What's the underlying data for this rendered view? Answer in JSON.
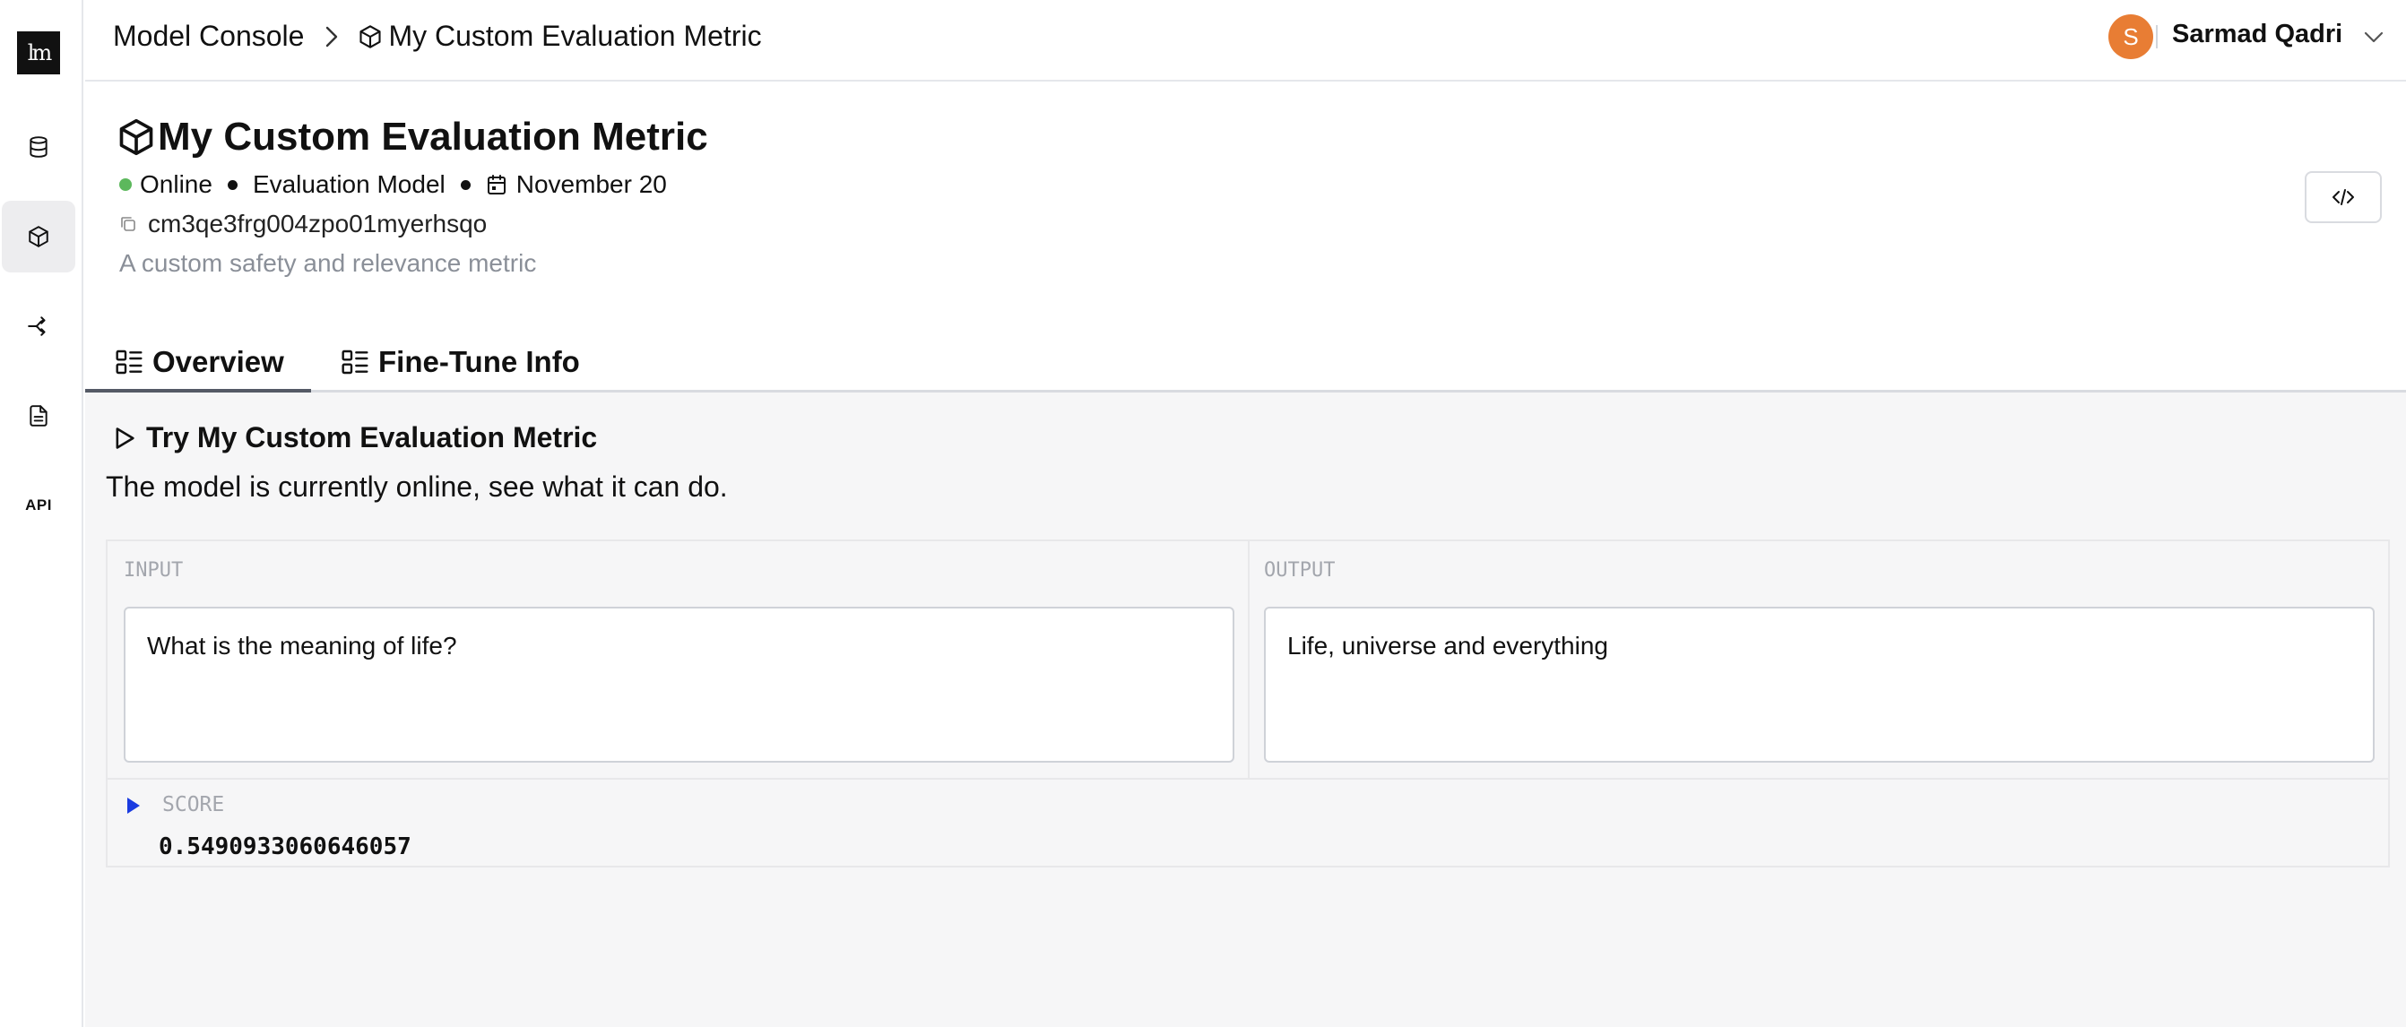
{
  "sidebar": {
    "logo_text": "lm",
    "items": [
      {
        "icon": "database-icon"
      },
      {
        "icon": "cube-icon",
        "active": true
      },
      {
        "icon": "flow-icon"
      },
      {
        "icon": "document-icon"
      },
      {
        "icon": "api-icon",
        "label": "API"
      }
    ]
  },
  "header": {
    "breadcrumb_root": "Model Console",
    "breadcrumb_current": "My Custom Evaluation Metric",
    "user_initial": "S",
    "user_name": "Sarmad Qadri",
    "avatar_color": "#e87d34"
  },
  "model": {
    "title": "My Custom Evaluation Metric",
    "status": "Online",
    "status_color": "#5cb85c",
    "type": "Evaluation Model",
    "date": "November 20",
    "id": "cm3qe3frg004zpo01myerhsqo",
    "description": "A custom safety and relevance metric"
  },
  "tabs": [
    {
      "label": "Overview",
      "active": true
    },
    {
      "label": "Fine-Tune Info",
      "active": false
    }
  ],
  "try": {
    "title": "Try My Custom Evaluation Metric",
    "subtitle": "The model is currently online, see what it can do.",
    "input_label": "INPUT",
    "input_value": "What is the meaning of life?",
    "output_label": "OUTPUT",
    "output_value": "Life, universe and everything",
    "score_label": "SCORE",
    "score_value": "0.5490933060646057"
  }
}
